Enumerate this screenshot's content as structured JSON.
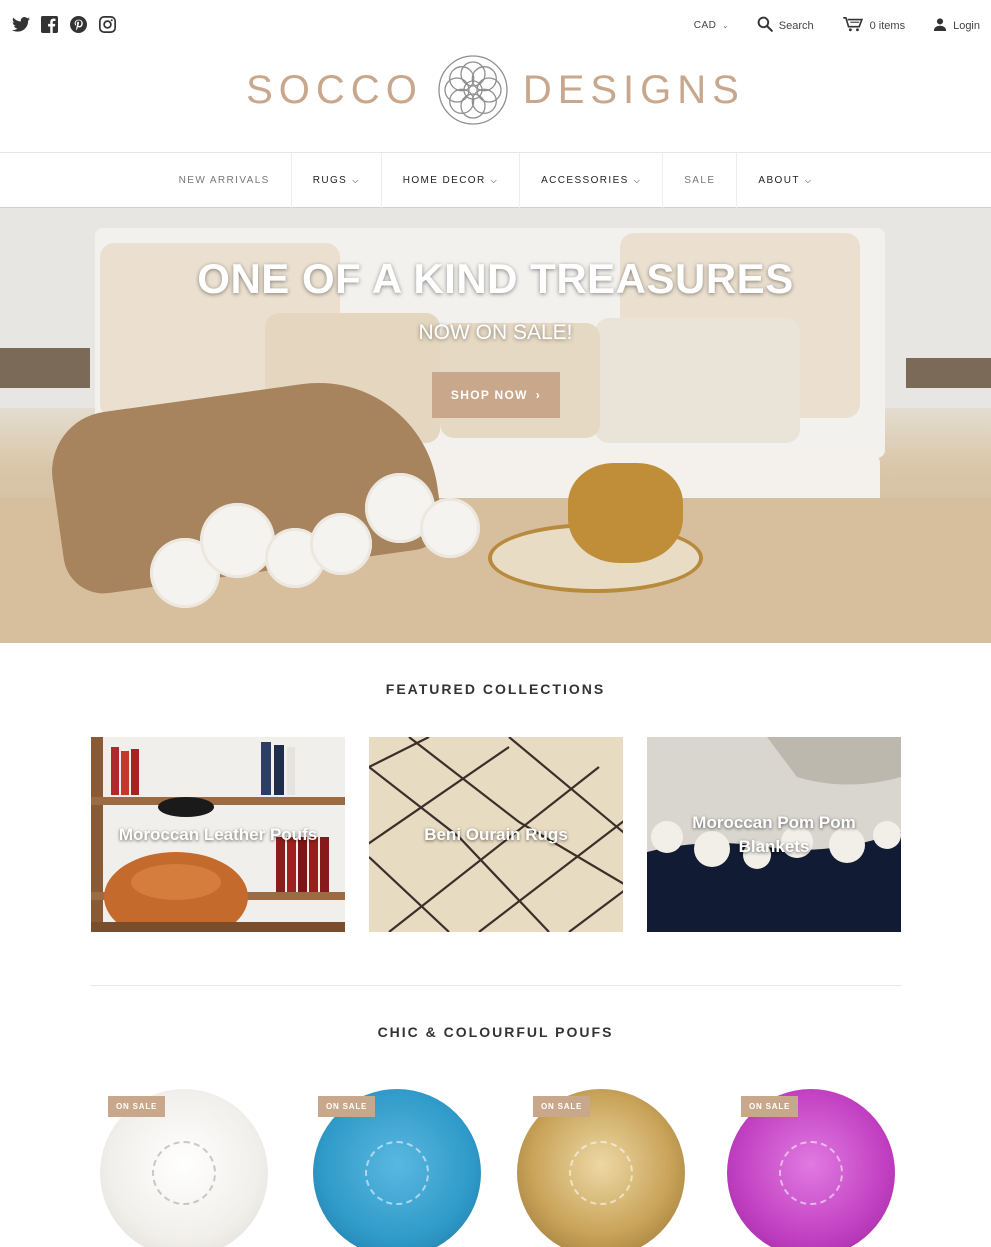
{
  "social": [
    {
      "name": "twitter-icon"
    },
    {
      "name": "facebook-icon"
    },
    {
      "name": "pinterest-icon"
    },
    {
      "name": "instagram-icon"
    }
  ],
  "utility": {
    "currency": "CAD",
    "search_label": "Search",
    "cart_label": "0 items",
    "login_label": "Login"
  },
  "logo": {
    "left_word": "SOCCO",
    "right_word": "DESIGNS",
    "color": "#c8a78c"
  },
  "nav": [
    {
      "label": "NEW ARRIVALS",
      "dropdown": false
    },
    {
      "label": "RUGS",
      "dropdown": true
    },
    {
      "label": "HOME DECOR",
      "dropdown": true
    },
    {
      "label": "ACCESSORIES",
      "dropdown": true
    },
    {
      "label": "SALE",
      "dropdown": false
    },
    {
      "label": "ABOUT",
      "dropdown": true
    }
  ],
  "hero": {
    "title": "ONE OF A KIND TREASURES",
    "subtitle": "NOW ON SALE!",
    "button": "SHOP NOW",
    "button_color": "#c9a78a"
  },
  "featured": {
    "title": "FEATURED COLLECTIONS",
    "items": [
      {
        "label": "Moroccan Leather Poufs"
      },
      {
        "label": "Beni Ourain Rugs"
      },
      {
        "label": "Moroccan Pom Pom Blankets"
      }
    ]
  },
  "poufs": {
    "title": "CHIC & COLOURFUL POUFS",
    "items": [
      {
        "badge": "ON SALE",
        "color": "#f3f1ee"
      },
      {
        "badge": "ON SALE",
        "color": "#2f9ac9"
      },
      {
        "badge": "ON SALE",
        "color": "#c9a45a"
      },
      {
        "badge": "ON SALE",
        "color": "#c13fc2"
      }
    ]
  }
}
